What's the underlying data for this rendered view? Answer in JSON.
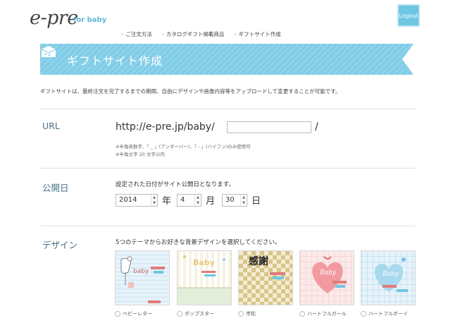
{
  "header": {
    "logo": "e-pre",
    "logo_sub": "for baby",
    "logout_label": "Logout"
  },
  "nav": [
    {
      "label": "ご注文方法"
    },
    {
      "label": "カタログギフト掲載商品"
    },
    {
      "label": "ギフトサイト作成"
    }
  ],
  "page": {
    "title": "ギフトサイト作成",
    "intro": "ギフトサイトは、最終注文を完了するまでの期間、自由にデザインや画像内容等をアップロードして変更することが可能です。"
  },
  "url_section": {
    "label": "URL",
    "prefix": "http://e-pre.jp/baby/",
    "input_value": "",
    "suffix": "/",
    "note1": "※半角英数字、「 _ 」(アンダーバー)、「 - 」(ハイフン)のみ使用可",
    "note2": "※半角文字 20 文字以内"
  },
  "date_section": {
    "label": "公開日",
    "description": "設定された日付がサイト公開日となります。",
    "year": "2014",
    "year_unit": "年",
    "month": "4",
    "month_unit": "月",
    "day": "30",
    "day_unit": "日"
  },
  "design_section": {
    "label": "デザイン",
    "description": "5つのテーマからお好きな背景デザインを選択してください。",
    "themes": [
      {
        "label": "ベビーレター",
        "thumb_text": "baby"
      },
      {
        "label": "ポップスター",
        "thumb_text": "Baby"
      },
      {
        "label": "市松",
        "thumb_text": "感謝"
      },
      {
        "label": "ハートフルガール",
        "thumb_text": "Baby"
      },
      {
        "label": "ハートフルボーイ",
        "thumb_text": "Baby"
      }
    ]
  },
  "colors": {
    "accent": "#6ec6e2",
    "ribbon": "#7ecbe6",
    "label": "#4a6f86"
  }
}
